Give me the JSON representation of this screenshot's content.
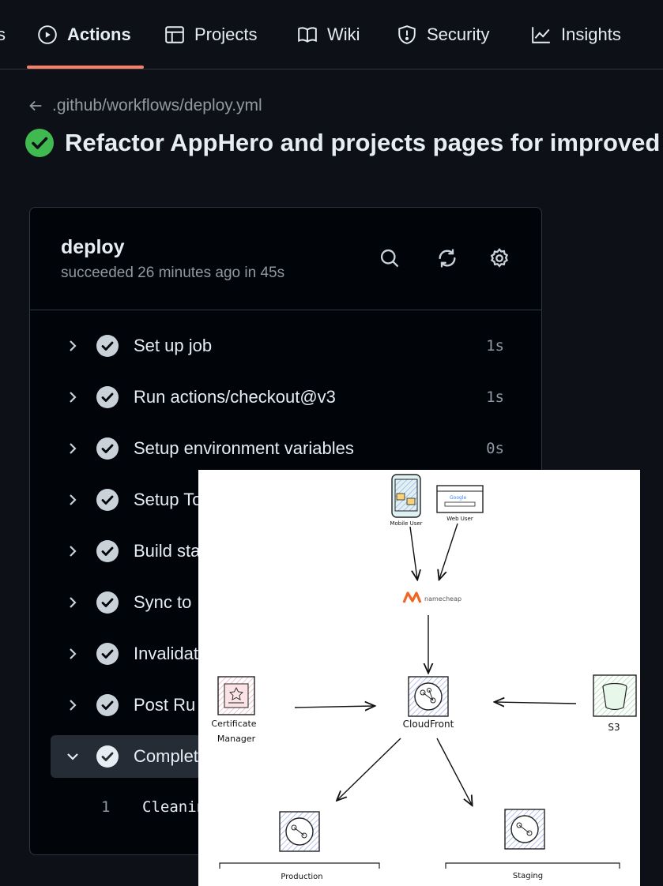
{
  "nav": {
    "partial_left": "s",
    "actions": "Actions",
    "projects": "Projects",
    "wiki": "Wiki",
    "security": "Security",
    "insights": "Insights"
  },
  "breadcrumb": ".github/workflows/deploy.yml",
  "run_title": "Refactor AppHero and projects pages for improved",
  "job": {
    "name": "deploy",
    "status_line": "succeeded 26 minutes ago in 45s"
  },
  "steps": [
    {
      "label": "Set up job",
      "duration": "1s"
    },
    {
      "label": "Run actions/checkout@v3",
      "duration": "1s"
    },
    {
      "label": "Setup environment variables",
      "duration": "0s"
    },
    {
      "label": "Setup To",
      "duration": ""
    },
    {
      "label": "Build sta",
      "duration": ""
    },
    {
      "label": "Sync to",
      "duration": ""
    },
    {
      "label": "Invalidat",
      "duration": ""
    },
    {
      "label": "Post Ru",
      "duration": ""
    },
    {
      "label": "Complet",
      "duration": ""
    }
  ],
  "log": {
    "line_number": "1",
    "text": "Cleanin"
  },
  "diagram": {
    "mobile_user": "Mobile User",
    "web_user": "Web User",
    "dns": "namecheap",
    "cloudfront": "CloudFront",
    "cert_line1": "Certificate",
    "cert_line2": "Manager",
    "s3": "S3",
    "production": "Production",
    "staging": "Staging"
  },
  "colors": {
    "background": "#0d1117",
    "accent_underline": "#f78166",
    "success": "#3fb950",
    "namecheap": "#f06522"
  }
}
